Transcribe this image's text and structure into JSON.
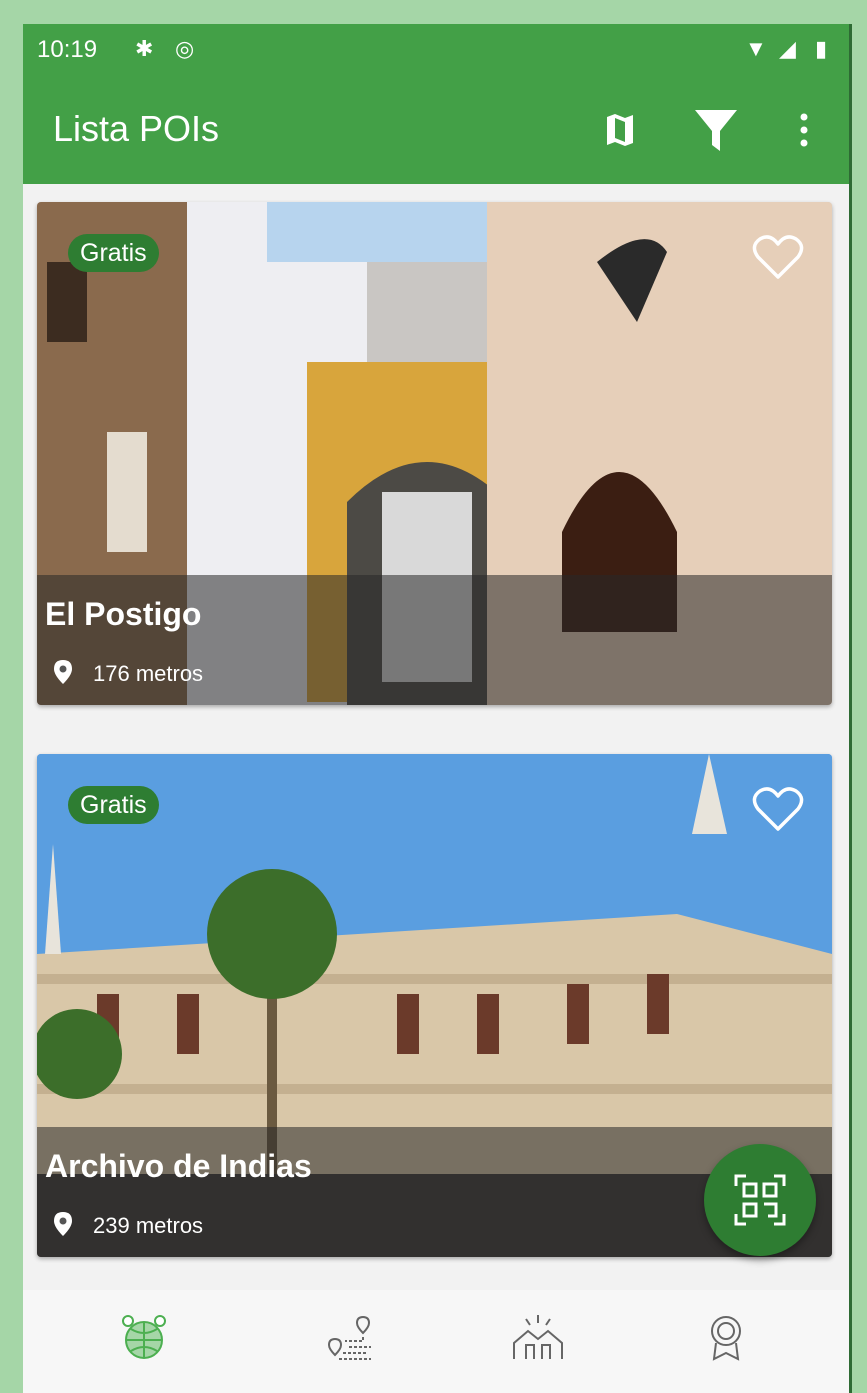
{
  "status_bar": {
    "time": "10:19"
  },
  "app_bar": {
    "title": "Lista POIs",
    "actions": [
      "map-icon",
      "filter-icon",
      "more-vert-icon"
    ]
  },
  "pois": [
    {
      "badge": "Gratis",
      "name": "El Postigo",
      "distance": "176 metros"
    },
    {
      "badge": "Gratis",
      "name": "Archivo de Indias",
      "distance": "239 metros"
    }
  ],
  "fab": {
    "icon": "qr-scan-icon"
  },
  "bottom_nav": [
    {
      "icon": "globe-pins-icon",
      "selected": true
    },
    {
      "icon": "route-icon",
      "selected": false
    },
    {
      "icon": "handshake-icon",
      "selected": false
    },
    {
      "icon": "award-badge-icon",
      "selected": false
    }
  ],
  "colors": {
    "primary": "#43a047",
    "accent": "#2e7d32",
    "background": "#a5d6a7"
  }
}
